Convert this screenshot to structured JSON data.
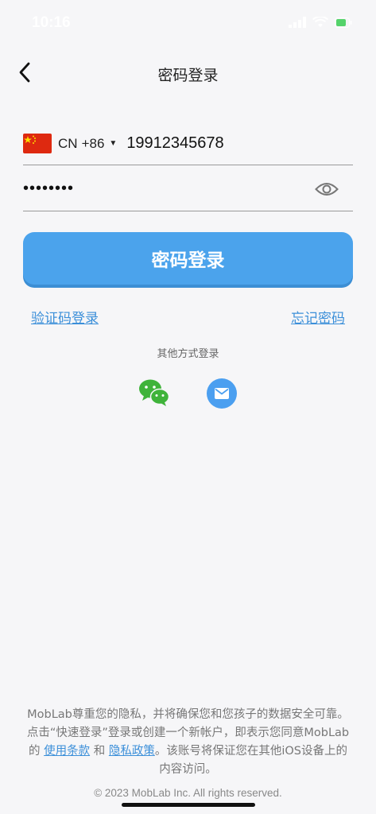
{
  "status_bar": {
    "time": "10:16"
  },
  "nav": {
    "title": "密码登录",
    "back_icon": "chevron-left-icon"
  },
  "phone": {
    "country_code": "CN",
    "dial_code": "+86",
    "flag": "china-flag-icon",
    "value": "19912345678"
  },
  "password": {
    "value": "••••••••",
    "toggle_icon": "eye-icon"
  },
  "login_button": {
    "label": "密码登录"
  },
  "links": {
    "sms_login": "验证码登录",
    "forgot_password": "忘记密码"
  },
  "other_login": {
    "label": "其他方式登录",
    "methods": [
      {
        "name": "wechat-icon"
      },
      {
        "name": "mail-icon"
      }
    ]
  },
  "footer": {
    "text_part1": "MobLab尊重您的隐私，并将确保您和您孩子的数据安全可靠。 点击“快速登录”登录或创建一个新帐户，即表示您同意MobLab的 ",
    "terms_link": "使用条款",
    "and": " 和 ",
    "privacy_link": "隐私政策",
    "text_part2": "。该账号将保证您在其他iOS设备上的内容访问。",
    "copyright": "© 2023 MobLab Inc. All rights reserved."
  },
  "colors": {
    "accent": "#4ba3ec",
    "link": "#3b8fd9",
    "background": "#f6f6f8",
    "wechat_green": "#3fb33a"
  }
}
